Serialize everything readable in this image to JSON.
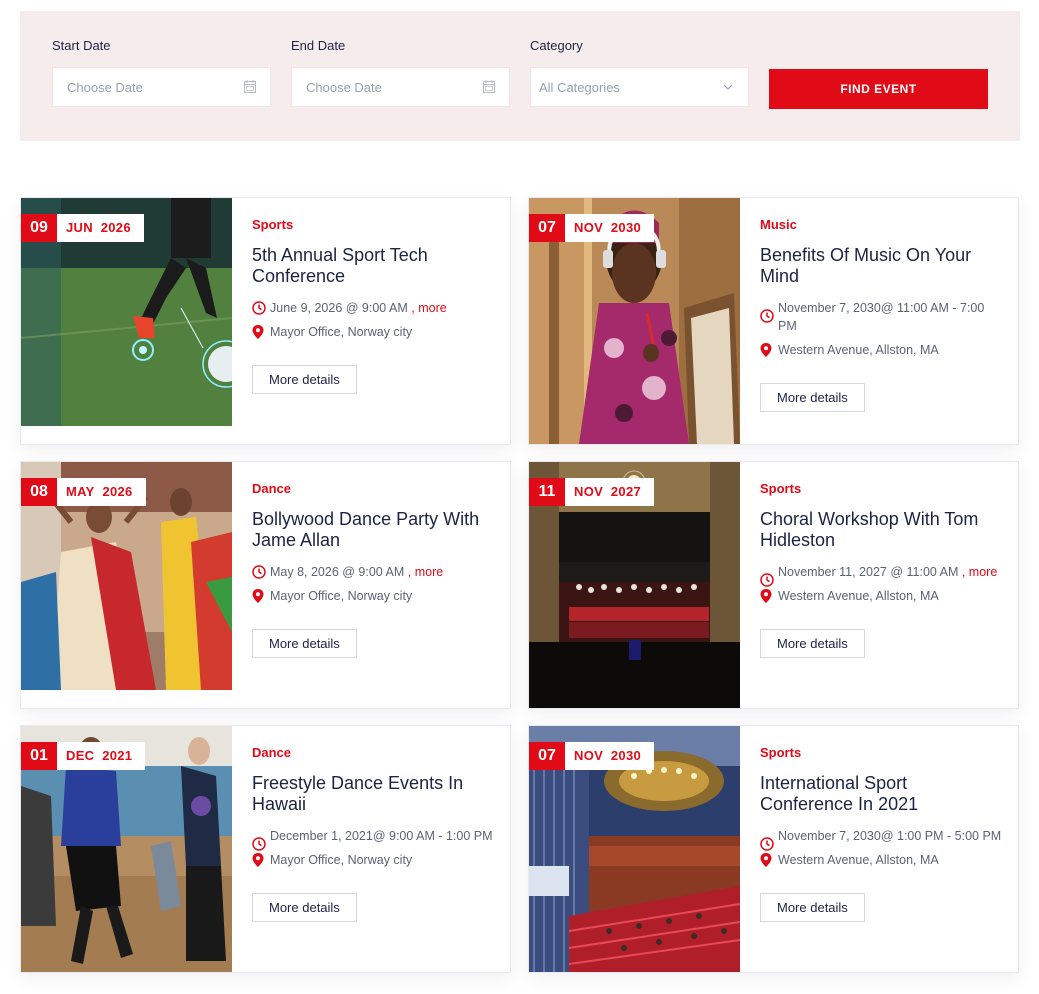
{
  "filters": {
    "start_date": {
      "label": "Start Date",
      "placeholder": "Choose Date",
      "icon": "calendar-icon"
    },
    "end_date": {
      "label": "End Date",
      "placeholder": "Choose Date",
      "icon": "calendar-icon"
    },
    "category": {
      "label": "Category",
      "value": "All Categories",
      "icon": "chevron-down-icon"
    },
    "find_button": "FIND EVENT"
  },
  "colors": {
    "accent": "#e10a17",
    "filter_bg": "#f6eceb",
    "text": "#1c2344"
  },
  "events": [
    {
      "day": "09",
      "month": "JUN",
      "year": "2026",
      "category": "Sports",
      "title": "5th Annual Sport Tech Conference",
      "time": "June 9, 2026 @ 9:00 AM",
      "more": " , more",
      "location": "Mayor Office, Norway city",
      "button": "More details"
    },
    {
      "day": "07",
      "month": "NOV",
      "year": "2030",
      "category": "Music",
      "title": "Benefits Of Music On Your Mind",
      "time": "November 7, 2030@ 11:00 AM - 7:00 PM",
      "more": "",
      "location": "Western Avenue, Allston, MA",
      "button": "More details"
    },
    {
      "day": "08",
      "month": "MAY",
      "year": "2026",
      "category": "Dance",
      "title": "Bollywood Dance Party With Jame Allan",
      "time": "May 8, 2026 @ 9:00 AM",
      "more": " , more",
      "location": "Mayor Office, Norway city",
      "button": "More details"
    },
    {
      "day": "11",
      "month": "NOV",
      "year": "2027",
      "category": "Sports",
      "title": "Choral Workshop With Tom Hidleston",
      "time": "November 11, 2027 @ 11:00 AM",
      "more": " , more",
      "location": "Western Avenue, Allston, MA",
      "button": "More details"
    },
    {
      "day": "01",
      "month": "DEC",
      "year": "2021",
      "category": "Dance",
      "title": "Freestyle Dance Events In Hawaii",
      "time": "December 1, 2021@ 9:00 AM - 1:00 PM",
      "more": "",
      "location": "Mayor Office, Norway city",
      "button": "More details"
    },
    {
      "day": "07",
      "month": "NOV",
      "year": "2030",
      "category": "Sports",
      "title": "International Sport Conference In 2021",
      "time": "November 7, 2030@ 1:00 PM - 5:00 PM",
      "more": "",
      "location": "Western Avenue, Allston, MA",
      "button": "More details"
    }
  ]
}
